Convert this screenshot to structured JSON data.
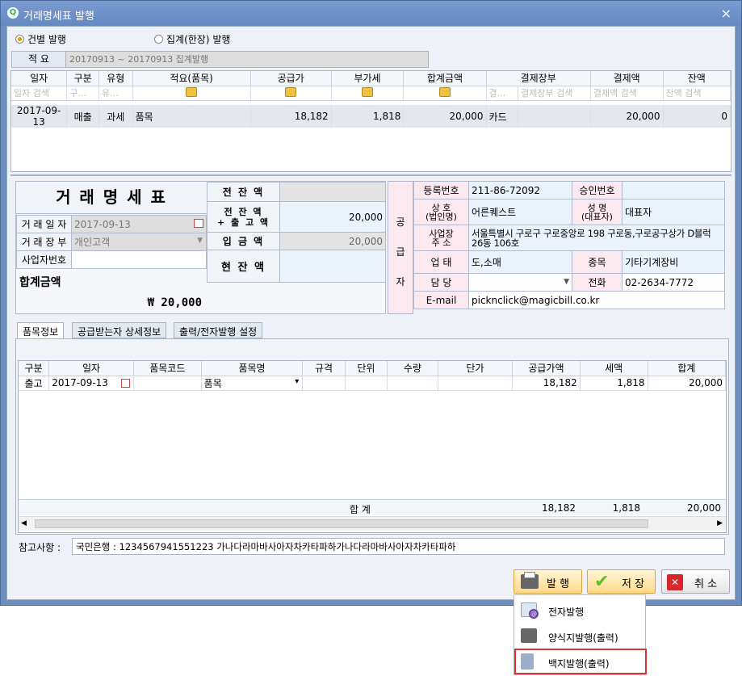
{
  "window": {
    "title": "거래명세표 발행",
    "close": "×"
  },
  "options": {
    "individual": "건별 발행",
    "aggregate": "집계(한장) 발행"
  },
  "summary": {
    "label": "적  요",
    "value": "20170913 ~ 20170913 집계발행"
  },
  "top_grid": {
    "headers": [
      "일자",
      "구분",
      "유형",
      "적요(품목)",
      "공급가",
      "부가세",
      "합계금액",
      "결제장부",
      "결제액",
      "잔액"
    ],
    "search": [
      "일자 검색",
      "구...",
      "유...",
      "",
      "",
      "",
      "",
      "결...",
      "결제장부 검색",
      "결제액 검색",
      "잔액 검색"
    ],
    "rows": [
      [
        "2017-09-13",
        "매출",
        "과세",
        "품목",
        "18,182",
        "1,818",
        "20,000",
        "카드",
        "",
        "20,000",
        "0"
      ]
    ]
  },
  "doc": {
    "title": "거 래 명 세 표",
    "date_label": "거 래 일 자",
    "date": "2017-09-13",
    "ledger_label": "거 래 장 부",
    "ledger": "개인고객",
    "biz_label": "사업자번호",
    "biz": "",
    "total_label": "합계금액",
    "total": "₩ 20,000"
  },
  "balances": {
    "prev_label": "전 잔 액",
    "prev": "",
    "prev_out_label1": "전 잔 액",
    "prev_out_label2": "+ 출 고 액",
    "prev_out": "20,000",
    "deposit_label": "입 금 액",
    "deposit": "20,000",
    "current_label": "현 잔 액",
    "current": ""
  },
  "supplier": {
    "side_label": [
      "공",
      "급",
      "자"
    ],
    "reg_label": "등록번호",
    "reg": "211-86-72092",
    "approval_label": "승인번호",
    "approval": "",
    "company_label1": "상  호",
    "company_label2": "(법인명)",
    "company": "어른퀘스트",
    "ceo_label1": "성  명",
    "ceo_label2": "(대표자)",
    "ceo": "대표자",
    "addr_label1": "사업장",
    "addr_label2": "주  소",
    "addr": "서울특별시 구로구 구로중앙로 198 구로동,구로공구상가 D블럭 26동 106호",
    "biz_type_label": "업  태",
    "biz_type": "도,소매",
    "item_label": "종목",
    "item": "기타기계장비",
    "manager_label": "담  당",
    "manager": "",
    "phone_label": "전화",
    "phone": "02-2634-7772",
    "email_label": "E-mail",
    "email": "picknclick@magicbill.co.kr"
  },
  "tabs": [
    "품목정보",
    "공급받는자 상세정보",
    "출력/전자발행 설정"
  ],
  "items_grid": {
    "headers": [
      "구분",
      "일자",
      "품목코드",
      "품목명",
      "규격",
      "단위",
      "수량",
      "단가",
      "공급가액",
      "세액",
      "합계"
    ],
    "rows": [
      [
        "출고",
        "2017-09-13",
        "",
        "품목",
        "",
        "",
        "",
        "",
        "18,182",
        "1,818",
        "20,000"
      ]
    ],
    "footer_label": "합 계",
    "footer": {
      "supply": "18,182",
      "tax": "1,818",
      "total": "20,000"
    }
  },
  "memo": {
    "label": "참고사항 :",
    "value": "국민은행 : 1234567941551223 가나다라마바사아자차카타파하가나다라마바사아자차카타파하"
  },
  "buttons": {
    "issue": "발 행",
    "save": "저 장",
    "cancel": "취 소"
  },
  "dropdown": {
    "items": [
      "전자발행",
      "양식지발행(출력)",
      "백지발행(출력)"
    ]
  },
  "colors": {
    "accent": "#6c8ebf",
    "highlight": "#d9343a",
    "save_green": "#5cbf2a",
    "cancel_red": "#d7262c"
  }
}
